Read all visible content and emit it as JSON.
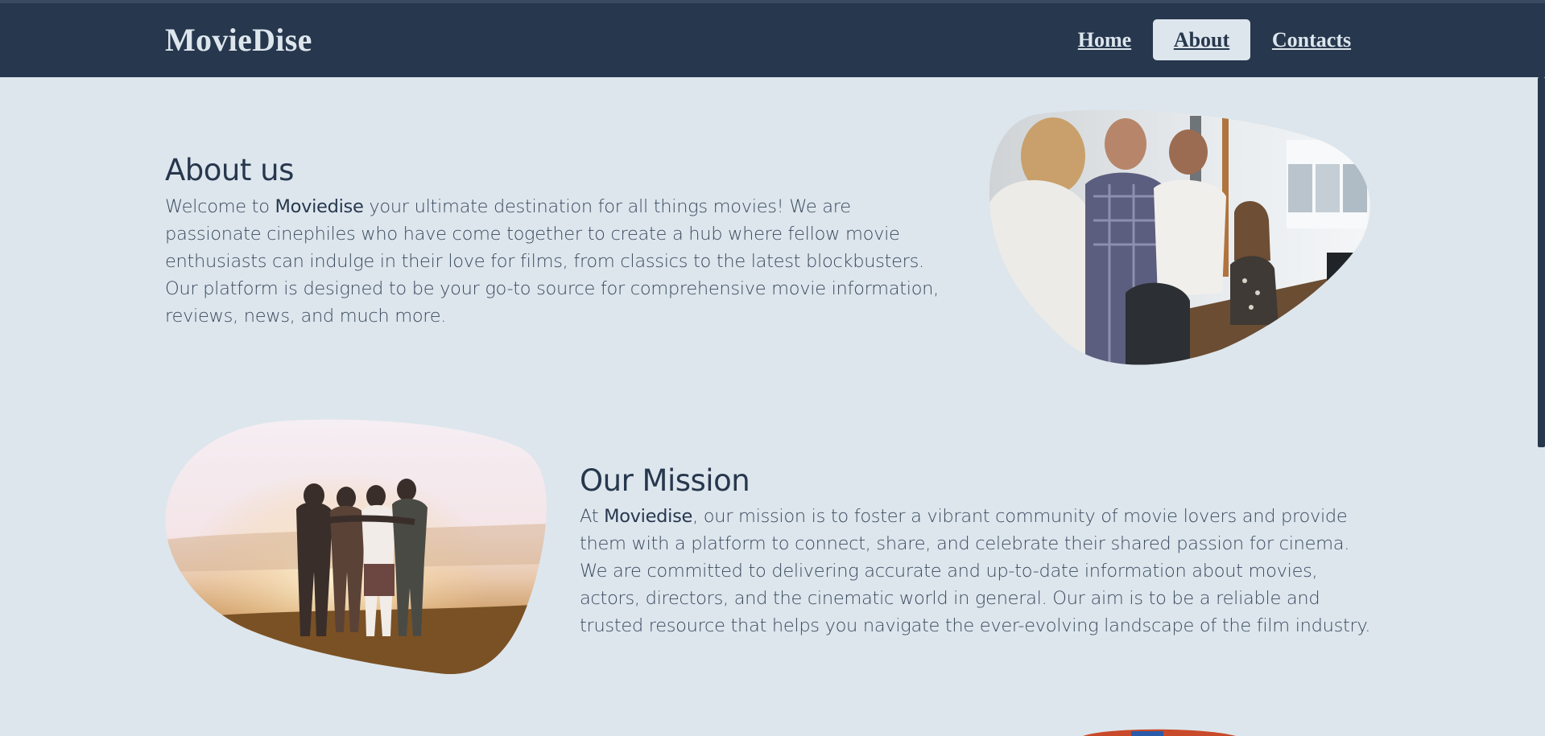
{
  "app": {
    "logo": "MovieDise"
  },
  "nav": {
    "items": [
      {
        "label": "Home",
        "active": false
      },
      {
        "label": "About",
        "active": true
      },
      {
        "label": "Contacts",
        "active": false
      }
    ]
  },
  "about": {
    "title": "About us",
    "text_prefix": "Welcome to ",
    "brand": "Moviedise",
    "text_body": " your ultimate destination for all things movies! We are passionate cinephiles who have come together to create a hub where fellow movie enthusiasts can indulge in their love for films, from classics to the latest blockbusters. Our platform is designed to be your go-to source for comprehensive movie information, reviews, news, and much more.",
    "image": "team-meeting-photo"
  },
  "mission": {
    "title": "Our Mission",
    "text_prefix": "At ",
    "brand": "Moviedise",
    "text_body": ", our mission is to foster a vibrant community of movie lovers and provide them with a platform to connect, share, and celebrate their shared passion for cinema. We are committed to delivering accurate and up-to-date information about movies, actors, directors, and the cinematic world in general. Our aim is to be a reliable and trusted resource that helps you navigate the ever-evolving landscape of the film industry.",
    "image": "friends-sunset-photo"
  },
  "colors": {
    "navbar": "#27374d",
    "background": "#dde6ed",
    "text": "#27374d",
    "active_nav_bg": "#dde6ed"
  }
}
